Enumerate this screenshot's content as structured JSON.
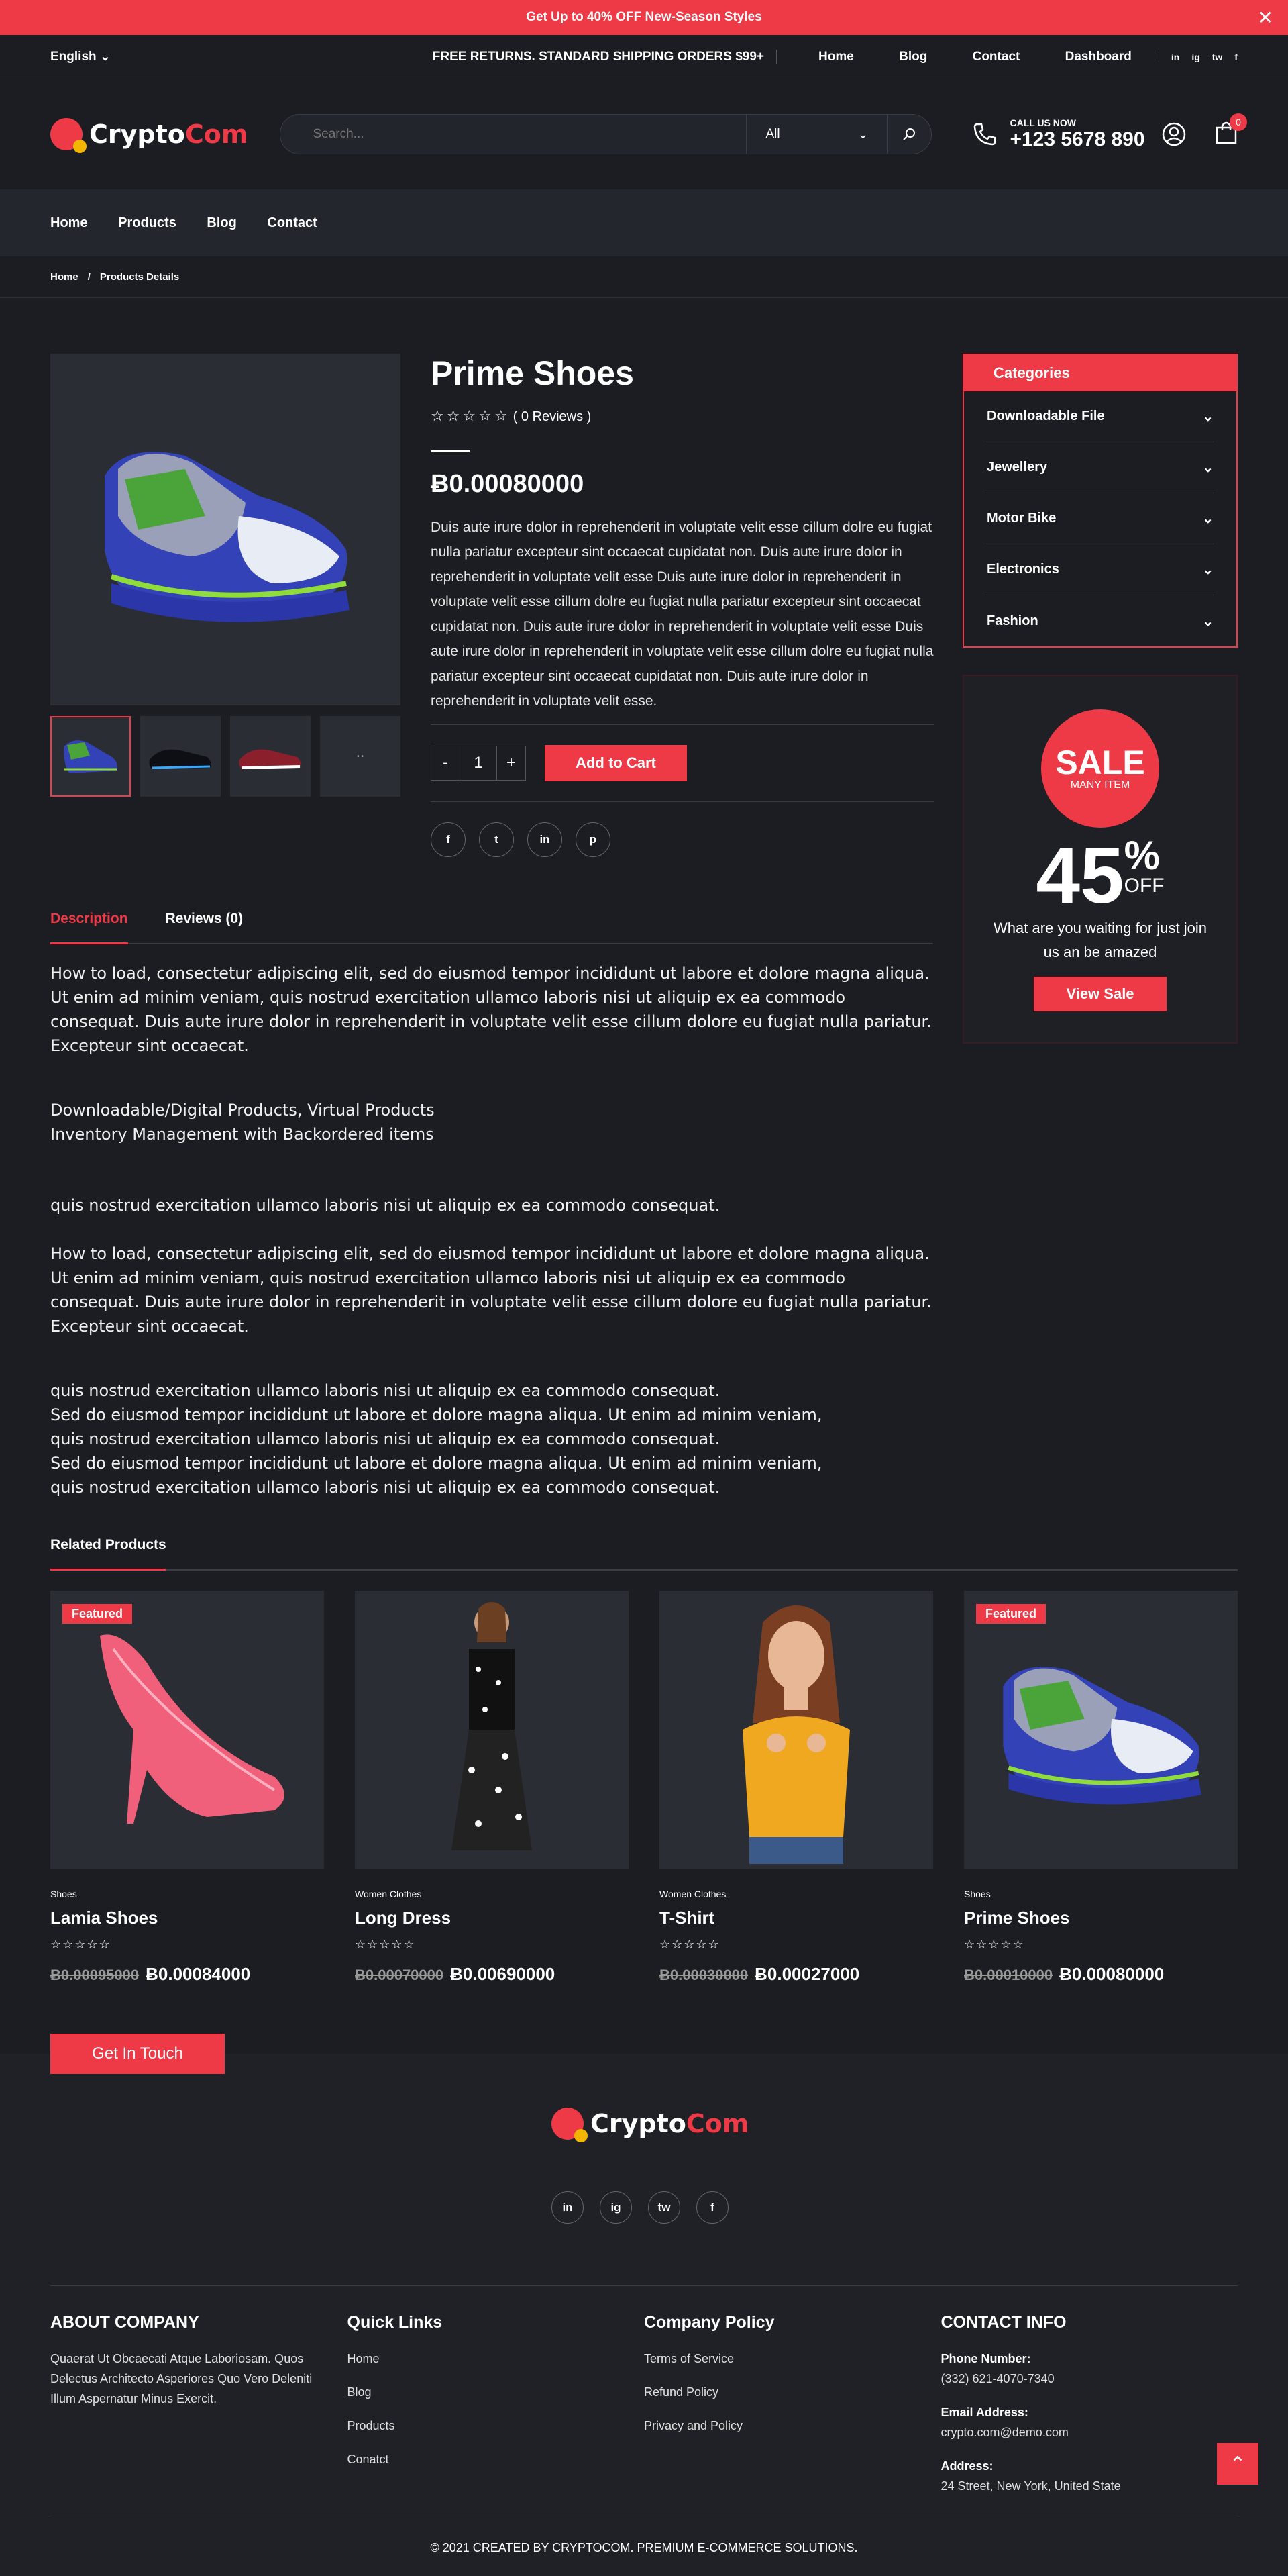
{
  "topbar": {
    "promo": "Get Up to 40% OFF New-Season Styles",
    "close": "✕"
  },
  "header": {
    "language": "English",
    "shipping": "FREE RETURNS. STANDARD SHIPPING ORDERS $99+",
    "nav": [
      "Home",
      "Blog",
      "Contact",
      "Dashboard"
    ],
    "social": [
      "in",
      "ig",
      "tw",
      "f"
    ]
  },
  "brand": {
    "part1": "Crypto",
    "part2": "Com"
  },
  "search": {
    "placeholder": "Search...",
    "category": "All"
  },
  "call": {
    "label": "CALL US NOW",
    "number": "+123 5678 890"
  },
  "cart": {
    "count": "0"
  },
  "mainnav": [
    "Home",
    "Products",
    "Blog",
    "Contact"
  ],
  "breadcrumb": {
    "home": "Home",
    "sep": "/",
    "current": "Products Details"
  },
  "product": {
    "title": "Prime Shoes",
    "stars": "☆☆☆☆☆",
    "reviews": "( 0 Reviews )",
    "price": "Ƀ0.00080000",
    "description": "Duis aute irure dolor in reprehenderit in voluptate velit esse cillum dolre eu fugiat nulla pariatur excepteur sint occaecat cupidatat non. Duis aute irure dolor in reprehenderit in voluptate velit esse Duis aute irure dolor in reprehenderit in voluptate velit esse cillum dolre eu fugiat nulla pariatur excepteur sint occaecat cupidatat non. Duis aute irure dolor in reprehenderit in voluptate velit esse Duis aute irure dolor in reprehenderit in voluptate velit esse cillum dolre eu fugiat nulla pariatur excepteur sint occaecat cupidatat non. Duis aute irure dolor in reprehenderit in voluptate velit esse.",
    "qty_minus": "-",
    "qty": "1",
    "qty_plus": "+",
    "add_to_cart": "Add to Cart",
    "shares": [
      "f",
      "t",
      "in",
      "p"
    ]
  },
  "tabs": {
    "description": "Description",
    "reviews": "Reviews (0)"
  },
  "tab_body": {
    "p1": "How to load, consectetur adipiscing elit, sed do eiusmod tempor incididunt ut labore et dolore magna aliqua. Ut enim ad minim veniam, quis nostrud exercitation ullamco laboris nisi ut aliquip ex ea commodo consequat. Duis aute irure dolor in reprehenderit in voluptate velit esse cillum dolore eu fugiat nulla pariatur. Excepteur sint occaecat.",
    "l1": "Downloadable/Digital Products, Virtual Products",
    "l2": "Inventory Management with Backordered items",
    "p2": "quis nostrud exercitation ullamco laboris nisi ut aliquip ex ea commodo consequat.",
    "p3": "How to load, consectetur adipiscing elit, sed do eiusmod tempor incididunt ut labore et dolore magna aliqua. Ut enim ad minim veniam, quis nostrud exercitation ullamco laboris nisi ut aliquip ex ea commodo consequat. Duis aute irure dolor in reprehenderit in voluptate velit esse cillum dolore eu fugiat nulla pariatur. Excepteur sint occaecat.",
    "q1": "quis nostrud exercitation ullamco laboris nisi ut aliquip ex ea commodo consequat.",
    "q2": "Sed do eiusmod tempor incididunt ut labore et dolore magna aliqua. Ut enim ad minim veniam,",
    "q3": "quis nostrud exercitation ullamco laboris nisi ut aliquip ex ea commodo consequat.",
    "q4": "Sed do eiusmod tempor incididunt ut labore et dolore magna aliqua. Ut enim ad minim veniam,",
    "q5": "quis nostrud exercitation ullamco laboris nisi ut aliquip ex ea commodo consequat."
  },
  "categories": {
    "title": "Categories",
    "items": [
      "Downloadable File",
      "Jewellery",
      "Motor Bike",
      "Electronics",
      "Fashion"
    ]
  },
  "sale": {
    "word": "SALE",
    "sub": "MANY ITEM",
    "pct": "45",
    "pct_sign": "%",
    "off": "OFF",
    "text": "What are you waiting for just join us an be amazed",
    "button": "View Sale"
  },
  "related": {
    "title": "Related Products",
    "items": [
      {
        "badge": "Featured",
        "cat": "Shoes",
        "name": "Lamia Shoes",
        "old": "Ƀ0.00095000",
        "price": "Ƀ0.00084000"
      },
      {
        "badge": "",
        "cat": "Women Clothes",
        "name": "Long Dress",
        "old": "Ƀ0.00070000",
        "price": "Ƀ0.00690000"
      },
      {
        "badge": "",
        "cat": "Women Clothes",
        "name": "T-Shirt",
        "old": "Ƀ0.00030000",
        "price": "Ƀ0.00027000"
      },
      {
        "badge": "Featured",
        "cat": "Shoes",
        "name": "Prime Shoes",
        "old": "Ƀ0.00010000",
        "price": "Ƀ0.00080000"
      }
    ]
  },
  "getintouch": "Get In Touch",
  "footer": {
    "about_title": "ABOUT COMPANY",
    "about_text": "Quaerat Ut Obcaecati Atque Laboriosam. Quos Delectus Architecto Asperiores Quo Vero Deleniti Illum Aspernatur Minus Exercit.",
    "quick_title": "Quick Links",
    "quick": [
      "Home",
      "Blog",
      "Products",
      "Conatct"
    ],
    "policy_title": "Company Policy",
    "policy": [
      "Terms of Service",
      "Refund Policy",
      "Privacy and Policy"
    ],
    "contact_title": "CONTACT INFO",
    "phone_label": "Phone Number:",
    "phone": "(332) 621-4070-7340",
    "email_label": "Email Address:",
    "email": "crypto.com@demo.com",
    "address_label": "Address:",
    "address": "24 Street, New York, United State",
    "copyright": "© 2021 CREATED BY CRYPTOCOM. PREMIUM E-COMMERCE SOLUTIONS."
  },
  "colors": {
    "accent": "#ee3a46",
    "bg": "#1b1d22",
    "panel": "#2a2d34"
  }
}
